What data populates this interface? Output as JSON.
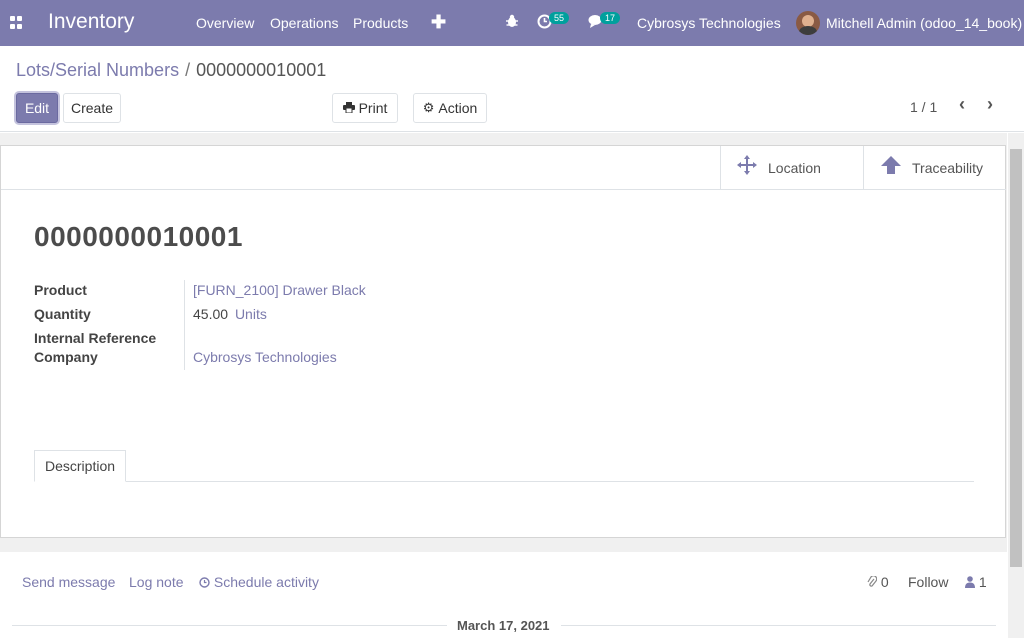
{
  "navbar": {
    "app_title": "Inventory",
    "menu": [
      "Overview",
      "Operations",
      "Products"
    ],
    "activity_count": "55",
    "message_count": "17",
    "company": "Cybrosys Technologies",
    "user": "Mitchell Admin (odoo_14_book)",
    "accent": "#7c7bad"
  },
  "breadcrumb": {
    "parent": "Lots/Serial Numbers",
    "separator": "/",
    "current": "0000000010001"
  },
  "toolbar": {
    "edit_label": "Edit",
    "create_label": "Create",
    "print_label": "Print",
    "action_label": "Action",
    "pager": "1 / 1"
  },
  "smart_buttons": {
    "location_label": "Location",
    "traceability_label": "Traceability"
  },
  "record": {
    "name": "0000000010001",
    "product_label": "Product",
    "product_value": "[FURN_2100] Drawer Black",
    "quantity_label": "Quantity",
    "quantity_value": "45.00",
    "quantity_uom": "Units",
    "internal_ref_label": "Internal Reference",
    "company_label": "Company",
    "company_value": "Cybrosys Technologies"
  },
  "tabs": {
    "description": "Description"
  },
  "chatter": {
    "send_message": "Send message",
    "log_note": "Log note",
    "schedule_activity": "Schedule activity",
    "attachments": "0",
    "follow": "Follow",
    "followers": "1",
    "date": "March 17, 2021"
  }
}
